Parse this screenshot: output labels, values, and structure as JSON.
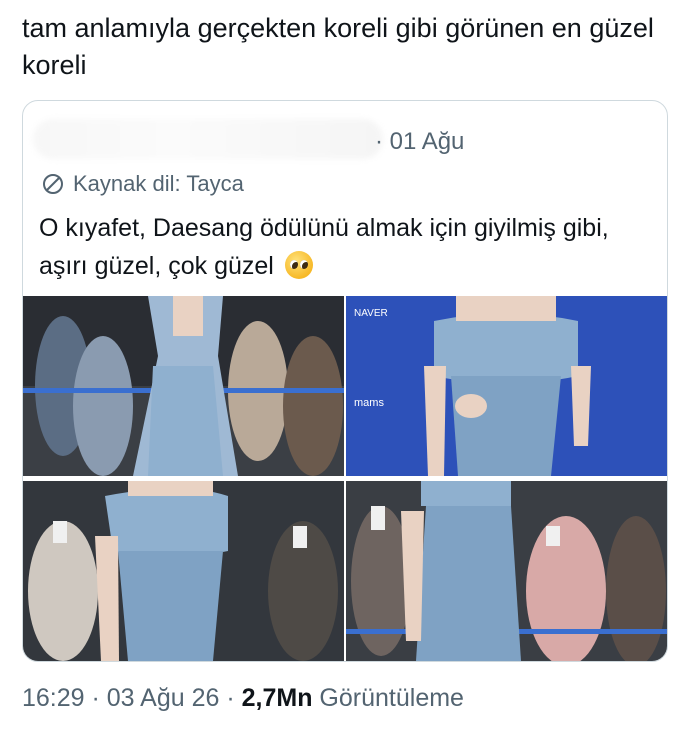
{
  "tweet": {
    "text": "tam anlamıyla gerçekten koreli gibi görünen en güzel koreli"
  },
  "quote": {
    "date": "· 01 Ağu",
    "source_label": "Kaynak dil: Tayca",
    "body": "O kıyafet, Daesang ödülünü almak için giyilmiş gibi, aşırı güzel, çok güzel",
    "emoji": "pleading-face-emoji",
    "photos": [
      {
        "alt": "photo-1"
      },
      {
        "alt": "photo-2",
        "sign_text_1": "NAVER",
        "sign_text_2": "mams"
      },
      {
        "alt": "photo-3"
      },
      {
        "alt": "photo-4"
      }
    ]
  },
  "footer": {
    "time": "16:29",
    "sep1": " · ",
    "date": "03 Ağu 26",
    "sep2": " · ",
    "views_count": "2,7Mn",
    "views_label": " Görüntüleme"
  },
  "colors": {
    "text": "#0f1419",
    "muted": "#536471",
    "border": "#cfd9de",
    "dress": "#8fb0cf"
  }
}
